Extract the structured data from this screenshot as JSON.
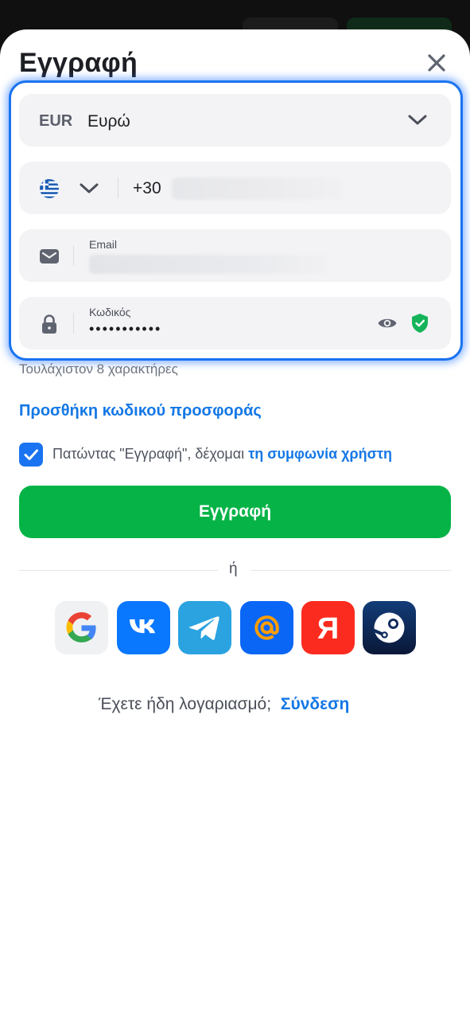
{
  "header": {
    "title": "Εγγραφή",
    "close_icon": "close-icon"
  },
  "currency": {
    "code": "EUR",
    "name": "Ευρώ"
  },
  "phone": {
    "country_flag": "greece-flag-icon",
    "dial_code": "+30",
    "value_blurred": true
  },
  "email": {
    "label": "Email",
    "value_blurred": true
  },
  "password": {
    "label": "Κωδικός",
    "value_masked": "•••••••••••",
    "hint": "Τουλάχιστον 8 χαρακτήρες"
  },
  "promo_link": "Προσθήκη κωδικού προσφοράς",
  "agreement": {
    "checked": true,
    "text": "Πατώντας \"Εγγραφή\", δέχομαι",
    "link": "τη συμφωνία χρήστη"
  },
  "register_button": "Εγγραφή",
  "divider_text": "ή",
  "social": [
    "google-icon",
    "vk-icon",
    "telegram-icon",
    "mailru-icon",
    "yandex-icon",
    "steam-icon"
  ],
  "footer": {
    "question": "Έχετε ήδη λογαριασμό;",
    "login_link": "Σύνδεση"
  },
  "colors": {
    "accent_blue": "#1478e6",
    "register_green": "#06b347",
    "focus_ring": "#1a73f0",
    "shield_green": "#15b45a"
  }
}
